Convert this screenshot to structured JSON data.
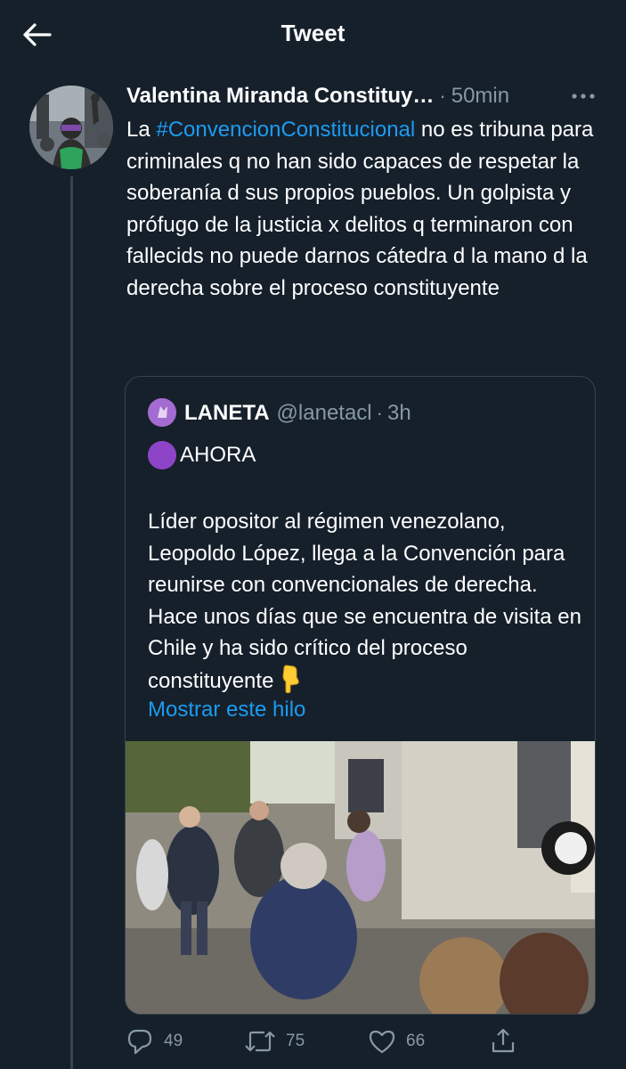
{
  "header": {
    "title": "Tweet",
    "back_icon": "arrow-left-icon"
  },
  "tweet": {
    "author_name": "Valentina Miranda Constituy…",
    "separator": "·",
    "time": "50min",
    "more_icon": "more-horizontal-icon",
    "text_before": "La ",
    "hashtag": "#ConvencionConstitucional",
    "text_after": " no es tribuna para criminales q no han sido capaces de respetar la soberanía d sus propios pueblos. Un golpista y prófugo de la justicia x delitos q terminaron con fallecids no puede darnos cátedra d la mano d la derecha sobre el proceso constituyente"
  },
  "quote": {
    "name": "LANETA",
    "handle": "@lanetacl",
    "separator": "·",
    "time": "3h",
    "emoji_label": "AHORA",
    "body": "Líder opositor al régimen venezolano, Leopoldo López, llega a la Convención para reunirse con convencionales de derecha. Hace unos días que se encuentra de visita en Chile y ha sido crítico del proceso constituyente",
    "show_thread": "Mostrar este hilo"
  },
  "actions": {
    "reply_count": "49",
    "retweet_count": "75",
    "like_count": "66"
  },
  "colors": {
    "background": "#15202b",
    "link": "#1d9bf0",
    "muted": "#8899a6",
    "border": "#38444d",
    "purple": "#8e44c8"
  }
}
